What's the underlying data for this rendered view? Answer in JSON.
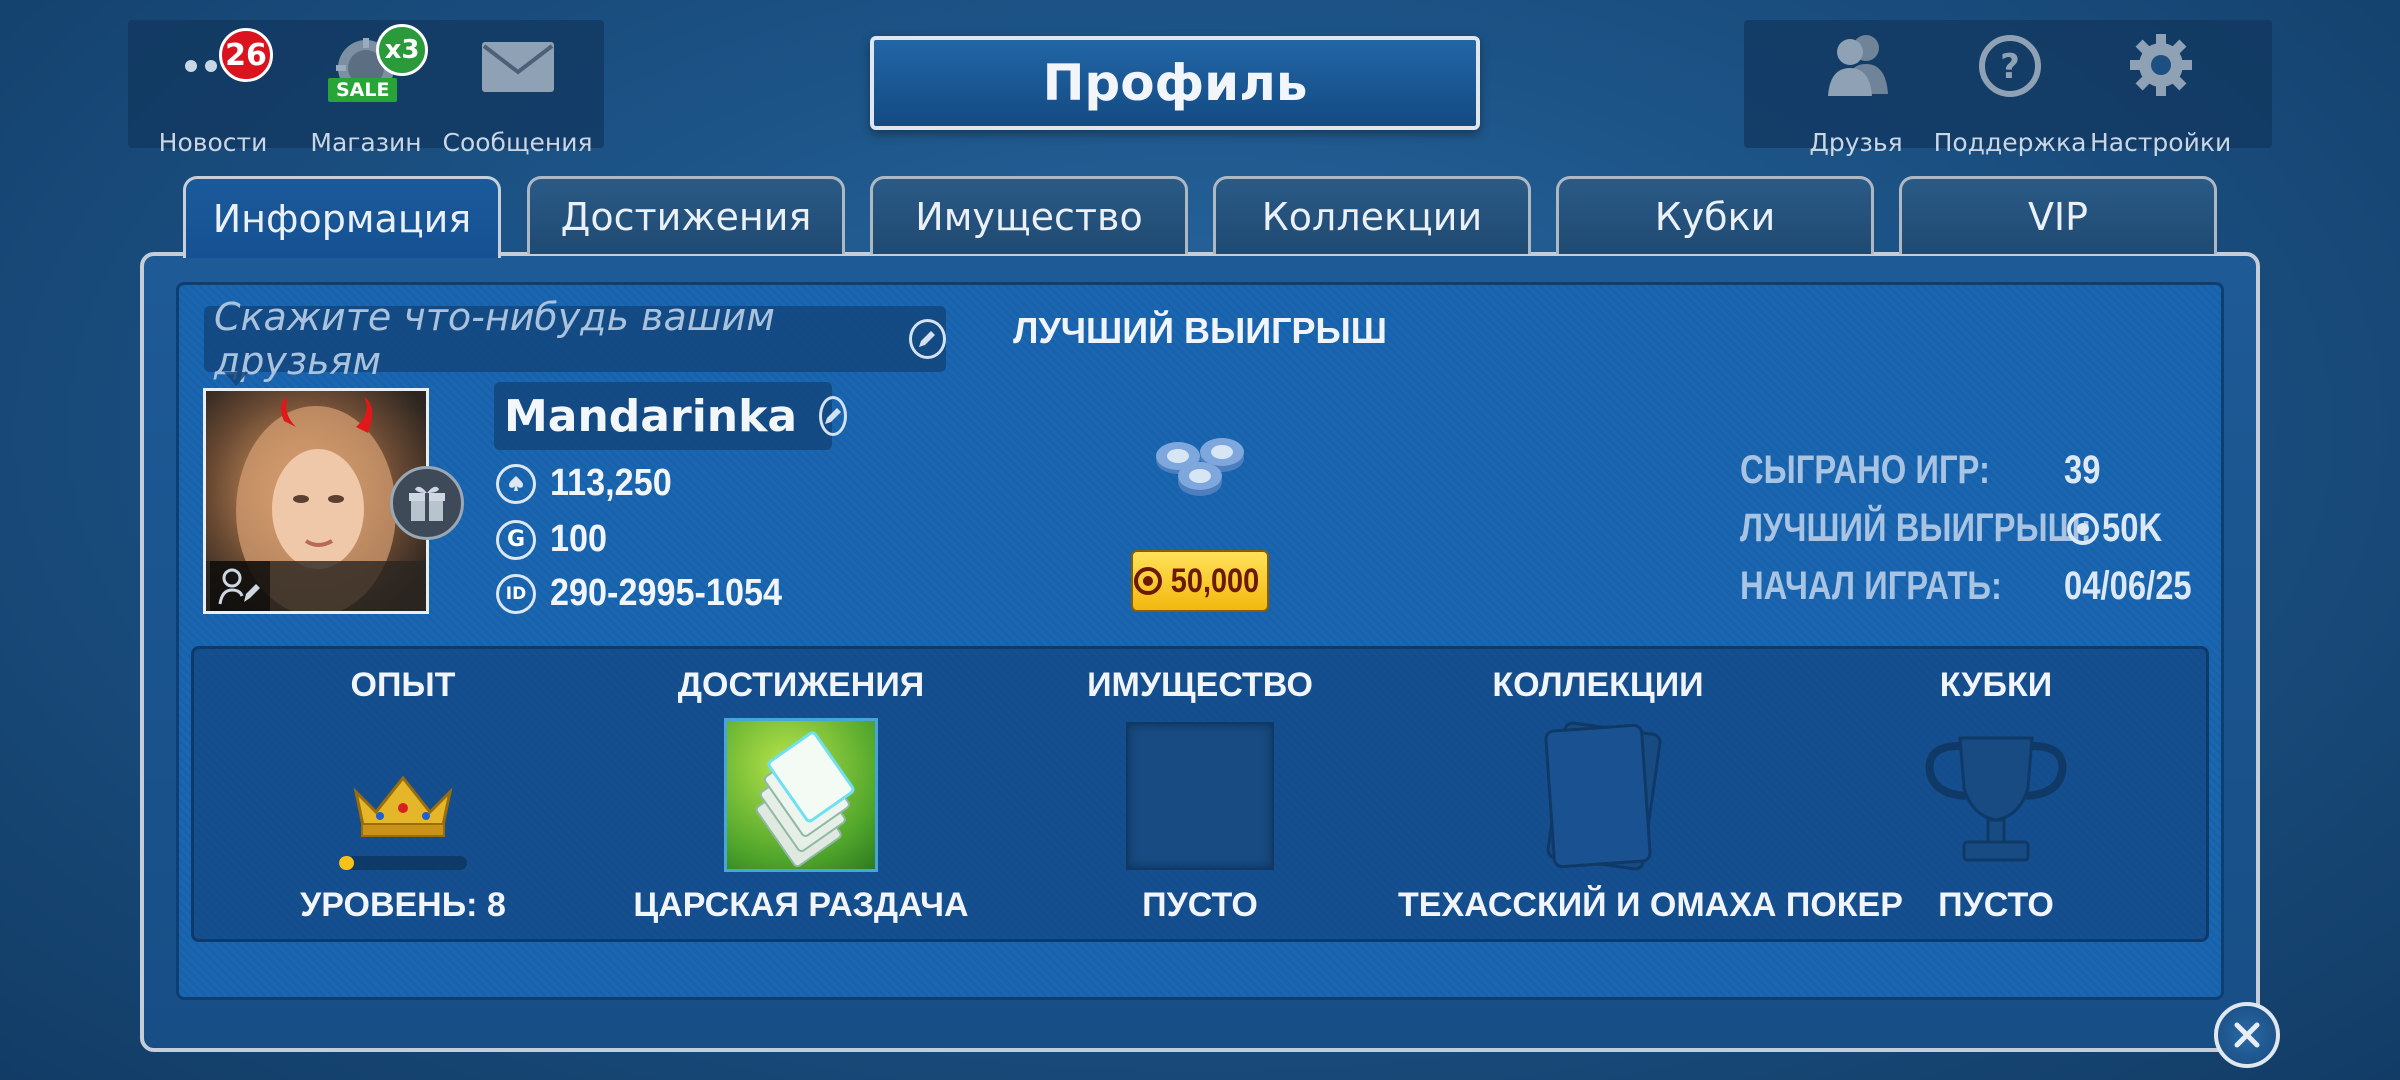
{
  "title": "Профиль",
  "topbar_left": [
    {
      "label": "Новости",
      "badge": "26",
      "icon": "dots-icon"
    },
    {
      "label": "Магазин",
      "badge": "x3",
      "sale": "SALE",
      "icon": "chip-icon"
    },
    {
      "label": "Сообщения",
      "icon": "envelope-icon"
    }
  ],
  "topbar_right": [
    {
      "label": "Друзья",
      "icon": "friends-icon"
    },
    {
      "label": "Поддержка",
      "icon": "help-icon"
    },
    {
      "label": "Настройки",
      "icon": "gear-icon"
    }
  ],
  "tabs": [
    "Информация",
    "Достижения",
    "Имущество",
    "Коллекции",
    "Кубки",
    "VIP"
  ],
  "active_tab": "Информация",
  "profile": {
    "status_placeholder": "Скажите что-нибудь вашим друзьям",
    "name": "Mandarinka",
    "chips": "113,250",
    "gold": "100",
    "gold_icon_letter": "G",
    "id_icon_text": "ID",
    "id": "290-2995-1054"
  },
  "best_win": {
    "title": "ЛУЧШИЙ ВЫИГРЫШ",
    "amount": "50,000"
  },
  "stats": [
    {
      "label": "СЫГРАНО ИГР:",
      "value": "39"
    },
    {
      "label": "ЛУЧШИЙ ВЫИГРЫШ:",
      "value": "50K"
    },
    {
      "label": "НАЧАЛ ИГРАТЬ:",
      "value": "04/06/25"
    }
  ],
  "sections": [
    {
      "title": "ОПЫТ",
      "caption": "УРОВЕНЬ: 8",
      "level_progress": 0.12
    },
    {
      "title": "ДОСТИЖЕНИЯ",
      "caption": "ЦАРСКАЯ РАЗДАЧА"
    },
    {
      "title": "ИМУЩЕСТВО",
      "caption": "ПУСТО"
    },
    {
      "title": "КОЛЛЕКЦИИ",
      "caption": "ТЕХАССКИЙ И ОМАХА ПОКЕР"
    },
    {
      "title": "КУБКИ",
      "caption": "ПУСТО"
    }
  ],
  "colors": {
    "accent": "#1a5ea6",
    "gold": "#f6c21a",
    "badge_red": "#d9141e",
    "badge_green": "#2b9a3a"
  }
}
